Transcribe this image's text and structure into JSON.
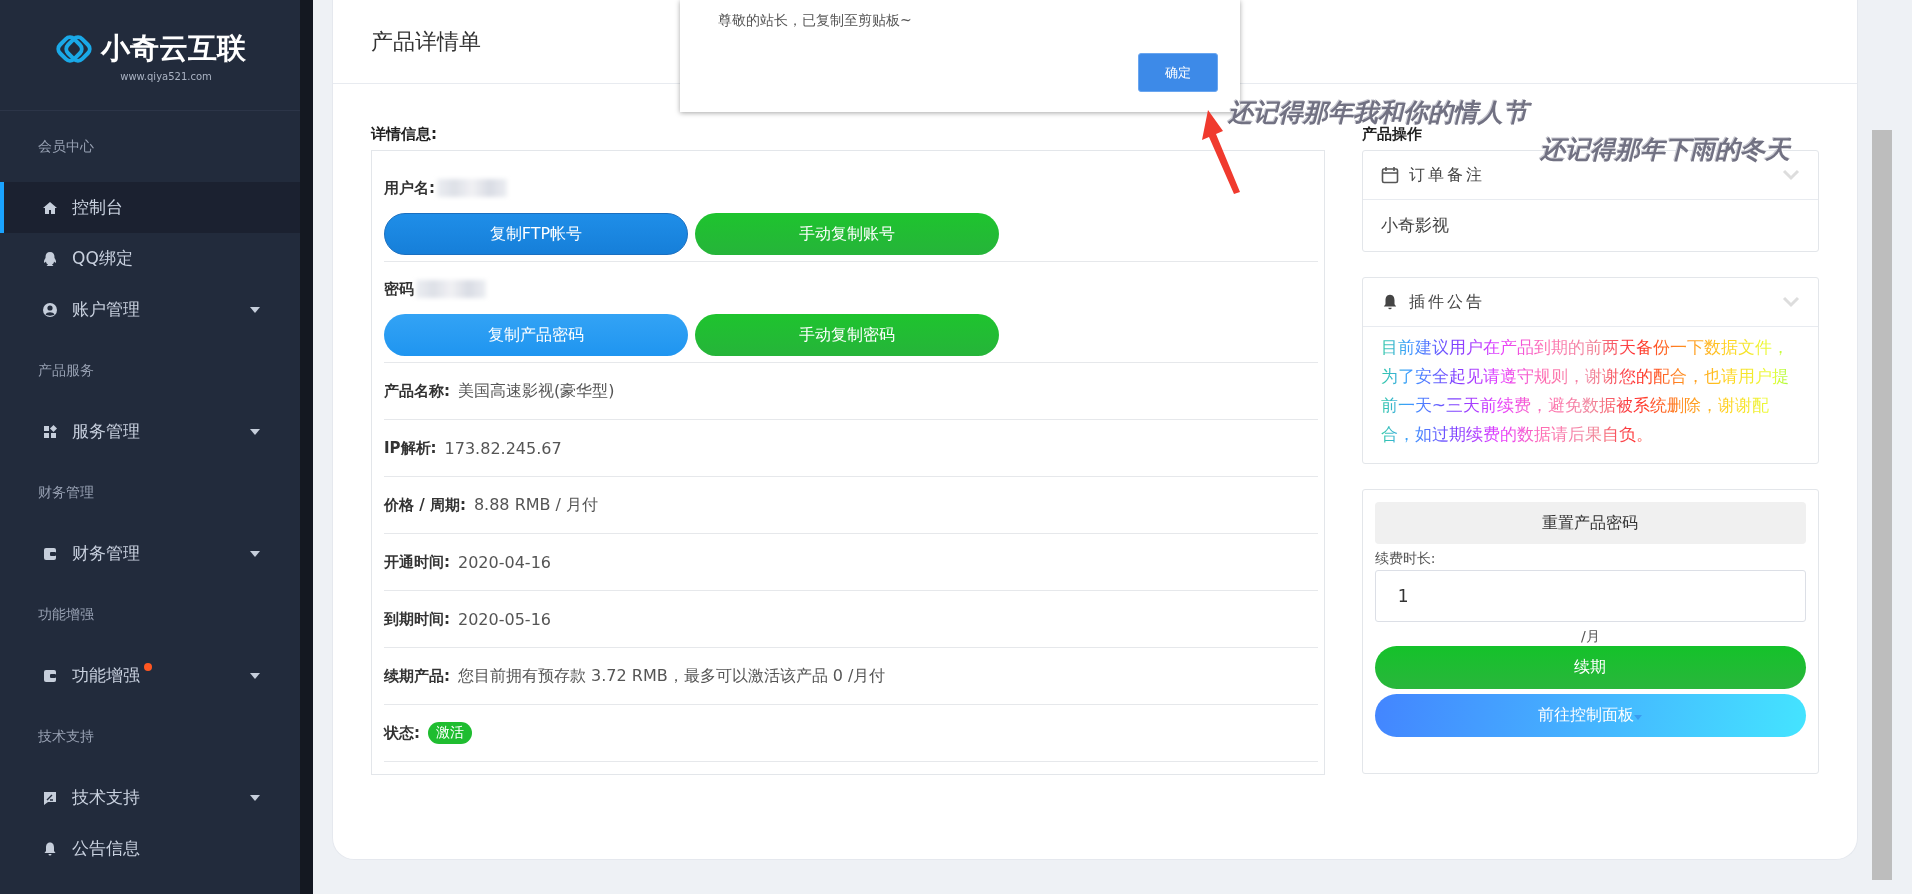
{
  "sidebar": {
    "logo": {
      "name": "小奇云互联",
      "url": "www.qiya521.com"
    },
    "sections": [
      {
        "label": "会员中心",
        "items": [
          {
            "label": "控制台",
            "selected": true,
            "expandable": false,
            "notification": false
          },
          {
            "label": "QQ绑定",
            "selected": false,
            "expandable": false,
            "notification": false
          },
          {
            "label": "账户管理",
            "selected": false,
            "expandable": true,
            "notification": false
          }
        ]
      },
      {
        "label": "产品服务",
        "items": [
          {
            "label": "服务管理",
            "selected": false,
            "expandable": true,
            "notification": false
          }
        ]
      },
      {
        "label": "财务管理",
        "items": [
          {
            "label": "财务管理",
            "selected": false,
            "expandable": true,
            "notification": false
          }
        ]
      },
      {
        "label": "功能增强",
        "items": [
          {
            "label": "功能增强",
            "selected": false,
            "expandable": true,
            "notification": true
          }
        ]
      },
      {
        "label": "技术支持",
        "items": [
          {
            "label": "技术支持",
            "selected": false,
            "expandable": true,
            "notification": false
          },
          {
            "label": "公告信息",
            "selected": false,
            "expandable": false,
            "notification": false
          }
        ]
      }
    ]
  },
  "page": {
    "title": "产品详情单"
  },
  "details": {
    "heading": "详情信息:",
    "credentials": [
      {
        "label": "用户名:",
        "buttons": [
          {
            "label": "复制FTP帐号",
            "kind": "primary"
          },
          {
            "label": "手动复制账号",
            "kind": "success"
          }
        ]
      },
      {
        "label": "密码",
        "buttons": [
          {
            "label": "复制产品密码",
            "kind": "info"
          },
          {
            "label": "手动复制密码",
            "kind": "success"
          }
        ]
      }
    ],
    "fields": [
      {
        "label": "产品名称:",
        "value": "美国高速影视(豪华型)"
      },
      {
        "label": "IP解析:",
        "value": "173.82.245.67"
      },
      {
        "label": "价格 / 周期:",
        "value": "8.88 RMB / 月付"
      },
      {
        "label": "开通时间:",
        "value": "2020-04-16"
      },
      {
        "label": "到期时间:",
        "value": "2020-05-16"
      },
      {
        "label": "续期产品:",
        "value": "您目前拥有预存款 3.72 RMB，最多可以激活该产品 0 /月付"
      }
    ],
    "status": {
      "label": "状态:",
      "badge": "激活"
    }
  },
  "operations": {
    "heading": "产品操作",
    "note": {
      "title": "订单备注",
      "body": "小奇影视"
    },
    "notice": {
      "title": "插件公告",
      "body": "目前建议用户在产品到期的前两天备份一下数据文件，为了安全起见请遵守规则，谢谢您的配合，也请用户提前一天~三天前续费，避免数据被系统删除，谢谢配合，如过期续费的数据请后果自负。"
    },
    "reset_button": "重置产品密码",
    "renew_label": "续费时长:",
    "renew_value": "1",
    "unit": "/月",
    "renew_button": "续期",
    "panel_button": "前往控制面板"
  },
  "dialog": {
    "message": "尊敬的站长，已复制至剪贴板~",
    "button": "确定"
  },
  "annotations": [
    {
      "text": "还记得那年我和你的情人节"
    },
    {
      "text": "还记得那年下雨的冬天"
    }
  ]
}
